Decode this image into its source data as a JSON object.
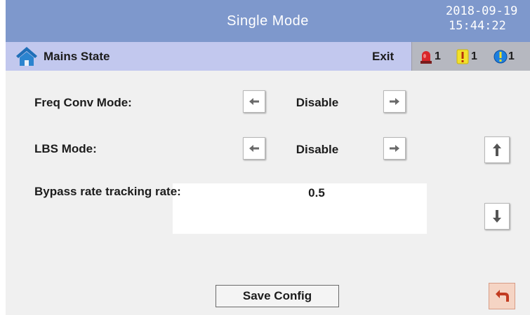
{
  "header": {
    "title": "Single Mode",
    "date": "2018-09-19",
    "time": "15:44:22"
  },
  "nav": {
    "icon": "home-icon",
    "label": "Mains State",
    "exit_label": "Exit"
  },
  "alarms": [
    {
      "icon": "siren-icon",
      "count": "1",
      "color": "#d8262a"
    },
    {
      "icon": "warning-icon",
      "count": "1",
      "color": "#f2e12b"
    },
    {
      "icon": "info-icon",
      "count": "1",
      "color": "#1c7fe0"
    }
  ],
  "settings": {
    "freq_conv": {
      "label": "Freq Conv Mode:",
      "value": "Disable"
    },
    "lbs": {
      "label": "LBS Mode:",
      "value": "Disable"
    },
    "bypass": {
      "label": "Bypass rate tracking rate:",
      "value": "0.5"
    }
  },
  "actions": {
    "save_label": "Save Config"
  },
  "colors": {
    "title_bar": "#7e98cc",
    "nav_bar": "#c2c8ee",
    "background": "#f0f0f0",
    "back_button": "#f5d4c4"
  }
}
